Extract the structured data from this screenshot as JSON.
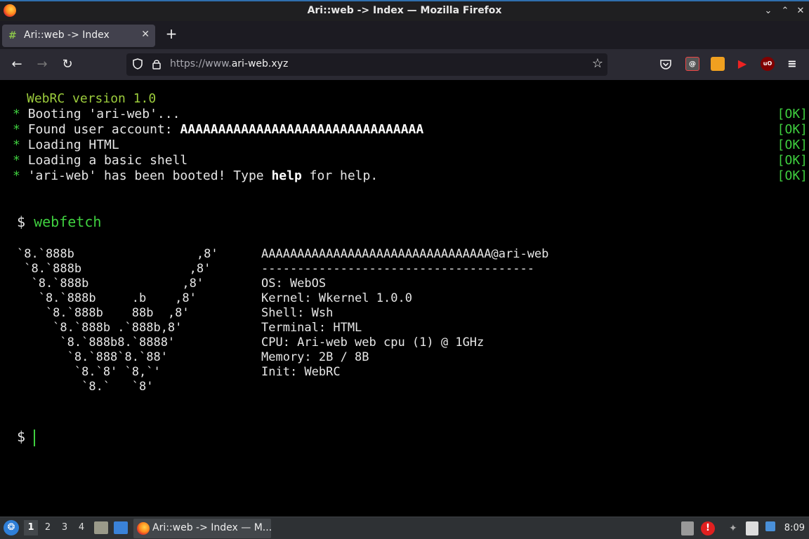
{
  "window": {
    "title": "Ari::web -> Index — Mozilla Firefox"
  },
  "tabs": [
    {
      "label": "Ari::web -> Index",
      "favicon": "ari-web-icon"
    }
  ],
  "address_bar": {
    "url_prefix": "https://www.",
    "url_domain": "ari-web.xyz"
  },
  "terminal": {
    "version_line": "WebRC version 1.0",
    "boot_lines": [
      {
        "bullet": "*",
        "text": "Booting 'ari-web'...",
        "status": "[OK]"
      },
      {
        "bullet": "*",
        "text_prefix": "Found user account: ",
        "text_bold": "AAAAAAAAAAAAAAAAAAAAAAAAAAAAAAAA",
        "status": "[OK]"
      },
      {
        "bullet": "*",
        "text": "Loading HTML",
        "status": "[OK]"
      },
      {
        "bullet": "*",
        "text": "Loading a basic shell",
        "status": "[OK]"
      },
      {
        "bullet": "*",
        "text_prefix": "'ari-web' has been booted! Type ",
        "text_bold": "help",
        "text_suffix": " for help.",
        "status": "[OK]"
      }
    ],
    "prompt_symbol": "$",
    "command": "webfetch",
    "ascii_art": [
      "`8.`888b                 ,8'",
      " `8.`888b               ,8'",
      "  `8.`888b             ,8'",
      "   `8.`888b     .b    ,8'",
      "    `8.`888b    88b  ,8'",
      "     `8.`888b .`888b,8'",
      "      `8.`888b8.`8888'",
      "       `8.`888`8.`88'",
      "        `8.`8' `8,`'",
      "         `8.`   `8'"
    ],
    "info_lines": [
      "AAAAAAAAAAAAAAAAAAAAAAAAAAAAAAAA@ari-web",
      "--------------------------------------",
      "OS: WebOS",
      "Kernel: Wkernel 1.0.0",
      "Shell: Wsh",
      "Terminal: HTML",
      "CPU: Ari-web web cpu (1) @ 1GHz",
      "Memory: 2B / 8B",
      "Init: WebRC"
    ],
    "final_prompt": "$"
  },
  "taskbar": {
    "workspaces": [
      "1",
      "2",
      "3",
      "4"
    ],
    "active_workspace": "1",
    "task_label": "Ari::web -> Index — M...",
    "clock": "8:09"
  },
  "colors": {
    "terminal_green": "#3fcf3f",
    "version_green": "#9ccc3c",
    "titlebar_accent": "#2f6fae"
  }
}
